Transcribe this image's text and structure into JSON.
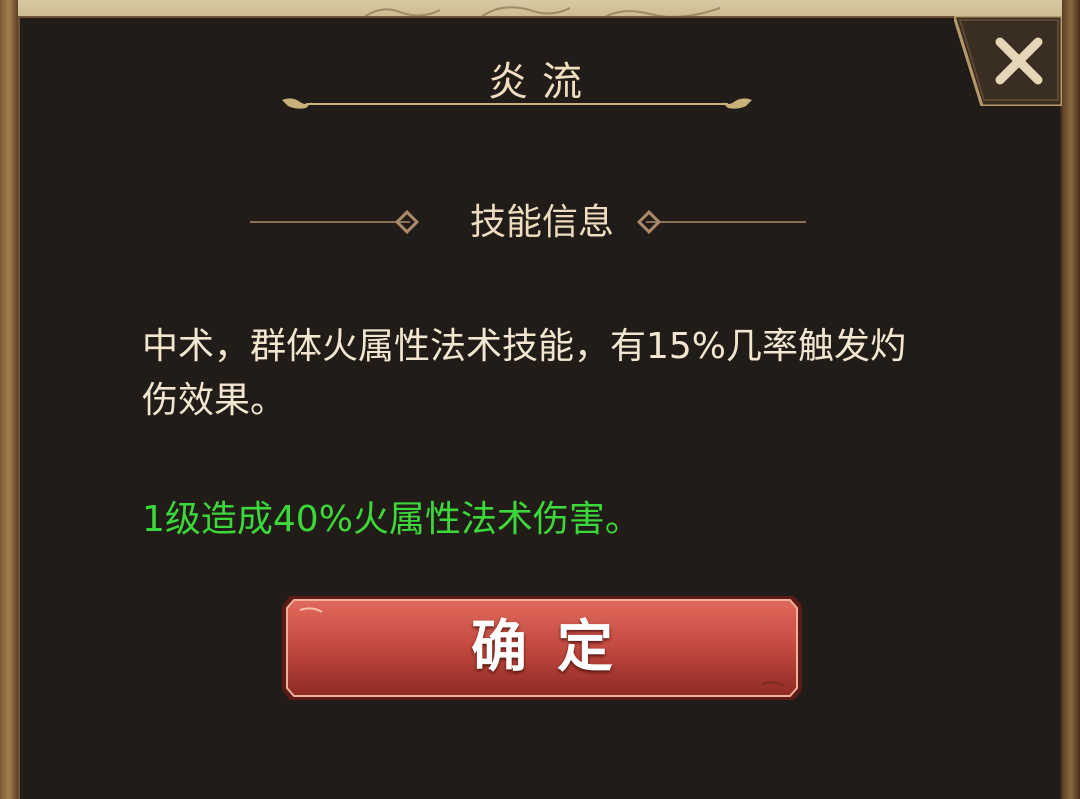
{
  "dialog": {
    "title": "炎流",
    "close_icon": "close-x-icon",
    "section_heading": "技能信息",
    "description": "中术，群体火属性法术技能，有15%几率触发灼伤效果。",
    "effect": "1级造成40%火属性法术伤害。",
    "confirm_label": "确定"
  },
  "colors": {
    "panel_bg": "#221c18",
    "title_text": "#f0dfc0",
    "body_text": "#f3e6d0",
    "effect_text": "#3bd83a",
    "button_red": "#c2493f",
    "gold_trim": "#c9b27a"
  }
}
